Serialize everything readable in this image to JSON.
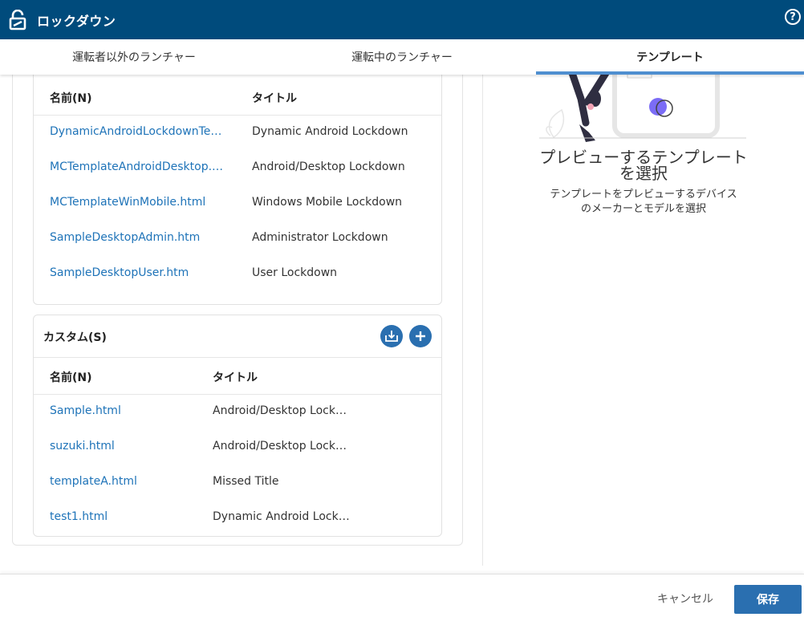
{
  "app": {
    "title": "ロックダウン",
    "help_icon": "?"
  },
  "tabs": [
    {
      "label": "運転者以外のランチャー",
      "active": false
    },
    {
      "label": "運転中のランチャー",
      "active": false
    },
    {
      "label": "テンプレート",
      "active": true
    }
  ],
  "preset": {
    "headers": {
      "name": "名前(N)",
      "title": "タイトル"
    },
    "rows": [
      {
        "name": "DynamicAndroidLockdownTe…",
        "title": "Dynamic Android Lockdown"
      },
      {
        "name": "MCTemplateAndroidDesktop.…",
        "title": "Android/Desktop Lockdown"
      },
      {
        "name": "MCTemplateWinMobile.html",
        "title": "Windows Mobile Lockdown"
      },
      {
        "name": "SampleDesktopAdmin.htm",
        "title": "Administrator Lockdown"
      },
      {
        "name": "SampleDesktopUser.htm",
        "title": "User Lockdown"
      }
    ]
  },
  "custom": {
    "label": "カスタム(S)",
    "headers": {
      "name": "名前(N)",
      "title": "タイトル"
    },
    "rows": [
      {
        "name": "Sample.html",
        "title": "Android/Desktop Lock…"
      },
      {
        "name": "suzuki.html",
        "title": "Android/Desktop Lock…"
      },
      {
        "name": "templateA.html",
        "title": "Missed Title"
      },
      {
        "name": "test1.html",
        "title": "Dynamic Android Lock…"
      }
    ],
    "import_icon": "import-icon",
    "add_icon": "plus-icon"
  },
  "preview": {
    "title_line1": "プレビューするテンプレート",
    "title_line2": "を選択",
    "subtitle_line1": "テンプレートをプレビューするデバイス",
    "subtitle_line2": "のメーカーとモデルを選択"
  },
  "footer": {
    "cancel_label": "キャンセル",
    "save_label": "保存"
  },
  "colors": {
    "header_bg": "#004b7c",
    "accent": "#2a6fb0",
    "link": "#1e73b8",
    "tab_indicator": "#4f8fd0"
  }
}
